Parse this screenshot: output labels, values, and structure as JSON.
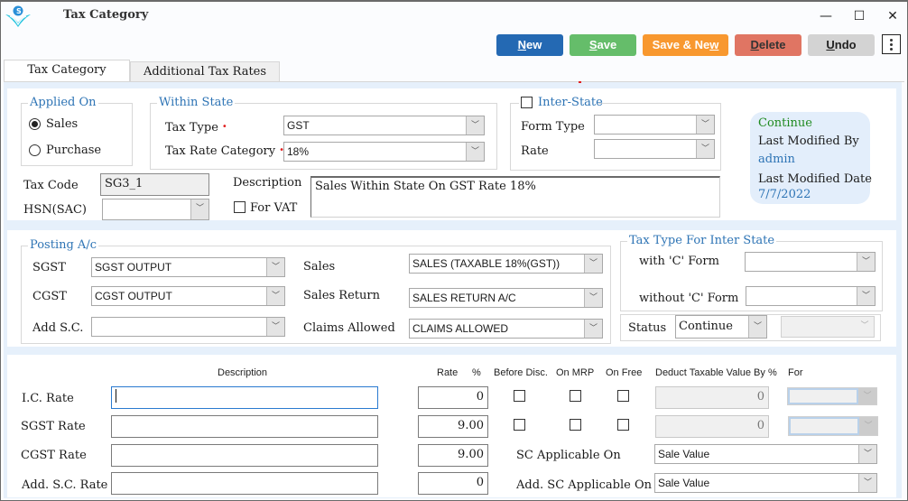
{
  "window": {
    "title": "Tax Category",
    "logo_icon": "app-logo-icon",
    "controls": {
      "minimize": "—",
      "maximize": "☐",
      "close": "✕"
    }
  },
  "toolbar": {
    "buttons": [
      {
        "id": "new",
        "pre": "",
        "ul": "N",
        "post": "ew",
        "color": "#2469b3"
      },
      {
        "id": "save",
        "pre": "",
        "ul": "S",
        "post": "ave",
        "color": "#65bd6a"
      },
      {
        "id": "save-new",
        "pre": "Save & Ne",
        "ul": "w",
        "post": "",
        "color": "#f8982f"
      },
      {
        "id": "delete",
        "pre": "",
        "ul": "D",
        "post": "elete",
        "color": "#e07563"
      },
      {
        "id": "undo",
        "pre": "",
        "ul": "U",
        "post": "ndo",
        "color": "#d3d3d3"
      }
    ],
    "more_icon": "kebab-menu-icon"
  },
  "tabs": [
    {
      "label": "Tax Category",
      "active": true
    },
    {
      "label": "Additional Tax Rates",
      "active": false
    }
  ],
  "applied_on": {
    "legend": "Applied On",
    "options": [
      {
        "label": "Sales",
        "checked": true
      },
      {
        "label": "Purchase",
        "checked": false
      }
    ]
  },
  "within_state": {
    "legend": "Within State",
    "tax_type_label": "Tax Type",
    "tax_type_value": "GST",
    "tax_rate_category_label": "Tax Rate Category",
    "tax_rate_category_value": "18%",
    "required_mark": "•"
  },
  "inter_state": {
    "legend": "Inter-State",
    "checked": false,
    "form_type_label": "Form Type",
    "form_type_value": "",
    "rate_label": "Rate",
    "rate_value": ""
  },
  "tax_code": {
    "label": "Tax Code",
    "value": "SG3_1"
  },
  "hsn": {
    "label": "HSN(SAC)",
    "value": ""
  },
  "description": {
    "label": "Description",
    "value": "Sales Within State On GST Rate 18%"
  },
  "for_vat": {
    "label": "For VAT",
    "checked": false
  },
  "info": {
    "status": "Continue",
    "modified_by_label": "Last Modified By",
    "modified_by": "admin",
    "modified_date_label": "Last Modified Date",
    "modified_date": "7/7/2022"
  },
  "posting": {
    "legend": "Posting A/c",
    "sgst_label": "SGST",
    "sgst_value": "SGST OUTPUT",
    "cgst_label": "CGST",
    "cgst_value": "CGST OUTPUT",
    "addsc_label": "Add S.C.",
    "addsc_value": "",
    "sales_label": "Sales",
    "sales_value": "SALES (TAXABLE 18%(GST))",
    "sales_return_label": "Sales Return",
    "sales_return_value": "SALES RETURN A/C",
    "claims_label": "Claims Allowed",
    "claims_value": "CLAIMS ALLOWED"
  },
  "inter_state_tax": {
    "legend": "Tax Type For Inter State",
    "with_c_label": "with 'C' Form",
    "with_c_value": "",
    "without_c_label": "without 'C' Form",
    "without_c_value": ""
  },
  "status": {
    "label": "Status",
    "value": "Continue",
    "secondary_value": ""
  },
  "rates": {
    "headers": {
      "description": "Description",
      "rate": "Rate",
      "percent": "%",
      "before_disc": "Before Disc.",
      "on_mrp": "On MRP",
      "on_free": "On Free",
      "deduct": "Deduct Taxable Value By %",
      "for": "For"
    },
    "rows": [
      {
        "label": "I.C. Rate",
        "description": "",
        "rate": "0",
        "before_disc": false,
        "on_mrp": false,
        "on_free": false,
        "deduct": "0",
        "for": ""
      },
      {
        "label": "SGST Rate",
        "description": "",
        "rate": "9.00",
        "before_disc": false,
        "on_mrp": false,
        "on_free": false,
        "deduct": "0",
        "for": ""
      },
      {
        "label": "CGST Rate",
        "description": "",
        "rate": "9.00"
      },
      {
        "label": "Add. S.C. Rate",
        "description": "",
        "rate": "0"
      }
    ],
    "sc_applicable_label": "SC Applicable On",
    "sc_applicable_value": "Sale Value",
    "add_sc_applicable_label": "Add. SC Applicable On",
    "add_sc_applicable_value": "Sale Value"
  }
}
